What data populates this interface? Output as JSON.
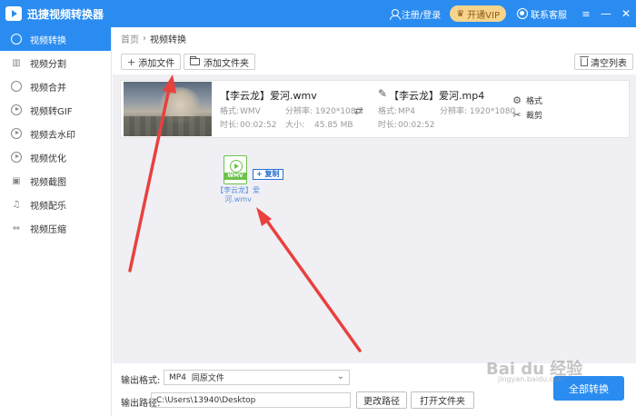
{
  "titlebar": {
    "app_title": "迅捷视频转换器",
    "login_label": "注册/登录",
    "vip_label": "开通VIP",
    "service_label": "联系客服",
    "menu_glyph": "≡",
    "minimize_glyph": "—",
    "close_glyph": "✕"
  },
  "sidebar": {
    "items": [
      {
        "label": "视频转换",
        "icon": "video-convert-icon",
        "active": true
      },
      {
        "label": "视频分割",
        "icon": "video-split-icon"
      },
      {
        "label": "视频合并",
        "icon": "video-merge-icon"
      },
      {
        "label": "视频转GIF",
        "icon": "video-gif-icon"
      },
      {
        "label": "视频去水印",
        "icon": "remove-watermark-icon"
      },
      {
        "label": "视频优化",
        "icon": "video-optimize-icon"
      },
      {
        "label": "视频截图",
        "icon": "video-screenshot-icon"
      },
      {
        "label": "视频配乐",
        "icon": "music-icon"
      },
      {
        "label": "视频压缩",
        "icon": "compress-icon"
      }
    ]
  },
  "breadcrumb": {
    "home": "首页",
    "separator": "›",
    "current": "视频转换"
  },
  "toolbar": {
    "add_file_label": "添加文件",
    "add_folder_label": "添加文件夹",
    "clear_list_label": "清空列表"
  },
  "file": {
    "source_name": "【李云龙】爱河.wmv",
    "target_name": "【李云龙】爱河.mp4",
    "source": {
      "format_label": "格式:",
      "format": "WMV",
      "resolution_label": "分辨率:",
      "resolution": "1920*1080",
      "duration_label": "时长:",
      "duration": "00:02:52",
      "size_label": "大小:",
      "size": "45.85 MB"
    },
    "target": {
      "format_label": "格式:",
      "format": "MP4",
      "resolution_label": "分辨率:",
      "resolution": "1920*1080",
      "duration_label": "时长:",
      "duration": "00:02:52"
    },
    "format_action_label": "格式",
    "cut_action_label": "裁剪"
  },
  "drag_ghost": {
    "file_type": "WMV",
    "name": "【李云龙】爱河.wmv",
    "copy_label": "复制"
  },
  "bottom": {
    "output_format_label": "输出格式:",
    "output_format_value": "MP4",
    "output_format_quality": "同原文件",
    "output_path_label": "输出路径:",
    "output_path_value": "C:\\Users\\13940\\Desktop",
    "change_path_label": "更改路径",
    "open_folder_label": "打开文件夹",
    "convert_all_label": "全部转换"
  },
  "watermark": {
    "text": "Bai du 经验",
    "sub": "jingyan.baidu.com"
  },
  "colors": {
    "accent": "#2a8cf0",
    "annotation_arrow": "#e8413e",
    "wmv_green": "#6cc24a"
  }
}
